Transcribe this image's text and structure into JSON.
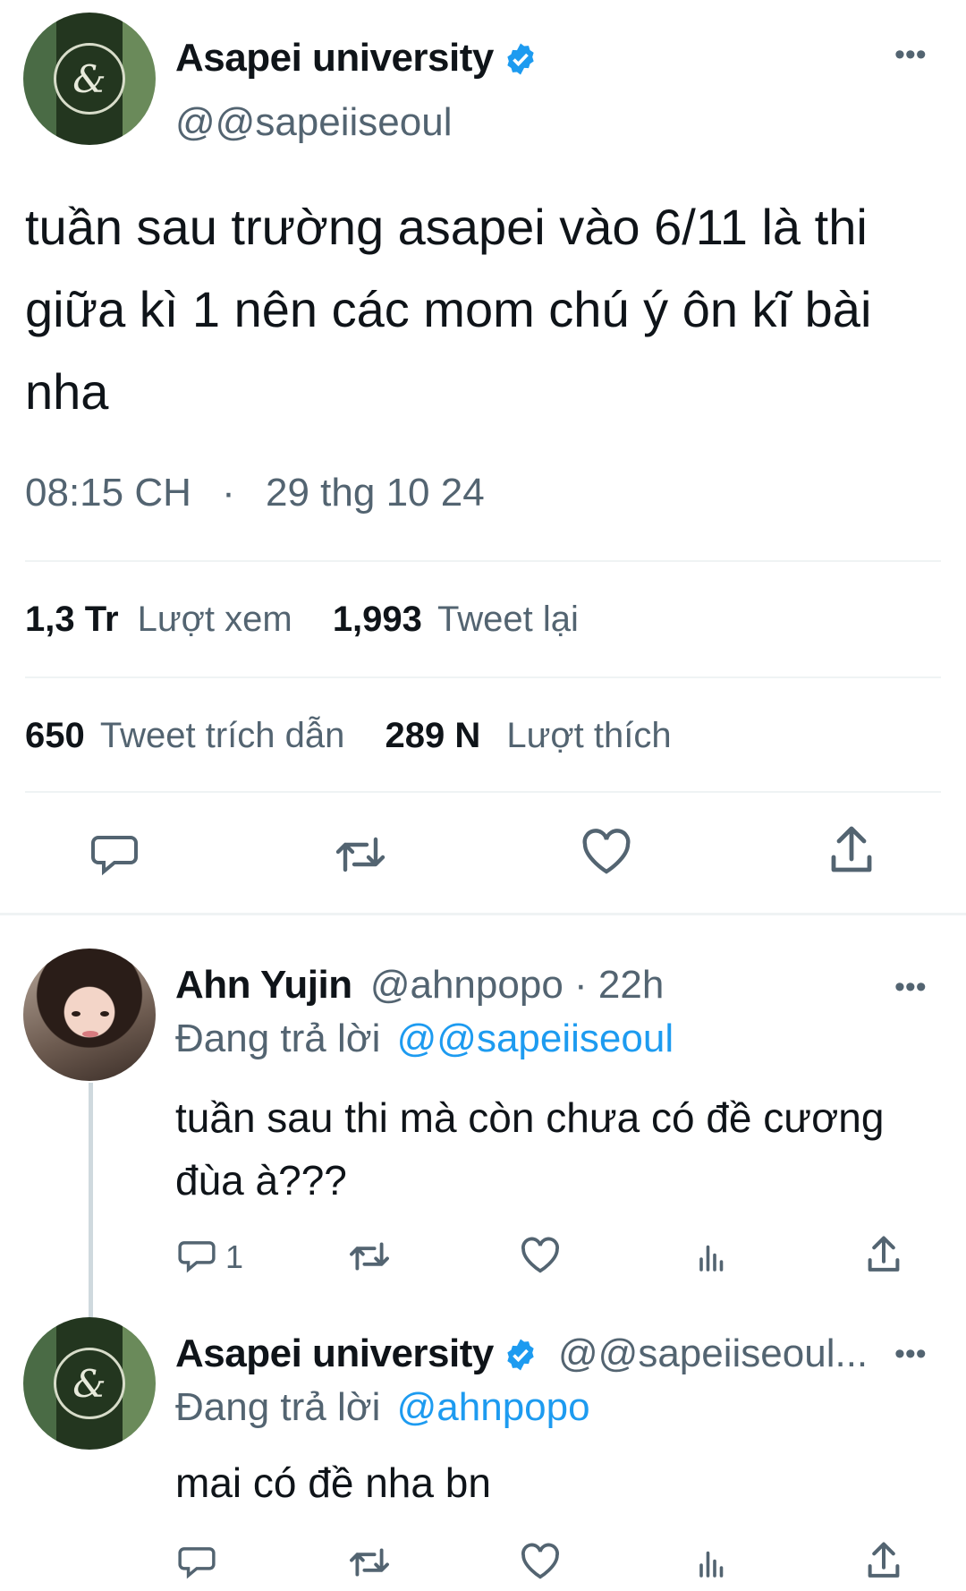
{
  "main_tweet": {
    "author_name": "Asapei university",
    "handle": "@@sapeiiseoul",
    "text": "tuần sau trường asapei vào 6/11 là thi giữa kì 1 nên các mom chú ý ôn kĩ bài nha",
    "time": "08:15 CH",
    "separator": "·",
    "date": "29 thg 10 24",
    "stats": {
      "views_count": "1,3 Tr",
      "views_label": "Lượt xem",
      "retweets_count": "1,993",
      "retweets_label": "Tweet lại",
      "quotes_count": "650",
      "quotes_label": "Tweet trích dẫn",
      "likes_count": "289 N",
      "likes_label": "Lượt thích"
    }
  },
  "replies": [
    {
      "author_name": "Ahn Yujin",
      "handle_time": "@ahnpopo · 22h",
      "replying_prefix": "Đang trả lời",
      "replying_to": "@@sapeiiseoul",
      "text": "tuần sau thi mà còn chưa có đề cương đùa à???",
      "reply_count": "1"
    },
    {
      "author_name": "Asapei university",
      "handle": "@@sapeiiseoul...",
      "replying_prefix": "Đang trả lời",
      "replying_to": "@ahnpopo",
      "text": "mai có đề nha bn"
    }
  ],
  "colors": {
    "accent": "#1d9bf0",
    "muted": "#536471",
    "text": "#0f1419",
    "divider": "#eff3f4"
  },
  "icons": [
    "more-icon",
    "verified-icon",
    "reply-icon",
    "retweet-icon",
    "like-icon",
    "share-icon",
    "views-icon"
  ]
}
